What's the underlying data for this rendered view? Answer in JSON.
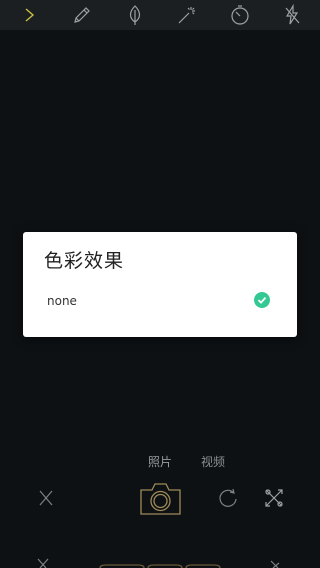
{
  "dialog": {
    "title": "色彩效果",
    "options": [
      {
        "label": "none",
        "selected": true
      }
    ]
  },
  "modes": {
    "photo": "照片",
    "video": "视频",
    "active": "photo"
  },
  "icons": {
    "top": [
      "chevron-right-icon",
      "pencil-icon",
      "leaf-icon",
      "magic-wand-icon",
      "timer-icon",
      "flash-off-icon"
    ],
    "bottom": [
      "close-icon",
      "camera-icon",
      "rotate-icon",
      "tools-icon"
    ]
  },
  "colors": {
    "accent": "#c8c040",
    "check": "#34c993",
    "shutter": "#a08a58",
    "background": "#0d1114",
    "topbar": "#1c1f22"
  }
}
